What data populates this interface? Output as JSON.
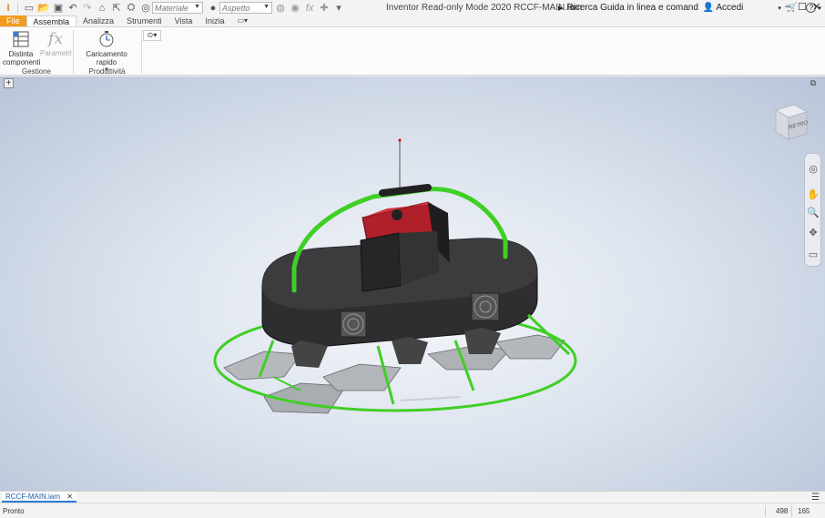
{
  "titlebar": {
    "title": "Inventor Read-only Mode 2020   RCCF-MAIN.iam",
    "material_placeholder": "Materiale",
    "appearance_placeholder": "Aspetto",
    "help_search": "Ricerca Guida in linea e comand",
    "signin": "Accedi",
    "help_glyph": "?"
  },
  "tabs": [
    "File",
    "Assembla",
    "Analizza",
    "Strumenti",
    "Vista",
    "Inizia"
  ],
  "ribbon": {
    "bom_line1": "Distinta",
    "bom_line2": "componenti",
    "params": "Parametri",
    "quick_load": "Caricamento rapido",
    "group_manage": "Gestione",
    "group_productivity": "Produttività"
  },
  "viewcube": {
    "label": "RETRO"
  },
  "document_tab": {
    "name": "RCCF-MAIN.iam",
    "close": "✕"
  },
  "status": {
    "text": "Pronto",
    "count1": "498",
    "count2": "165"
  },
  "colors": {
    "file_tab": "#f29c1f",
    "frame_green": "#3fcf25",
    "motor_red": "#b0202a"
  }
}
